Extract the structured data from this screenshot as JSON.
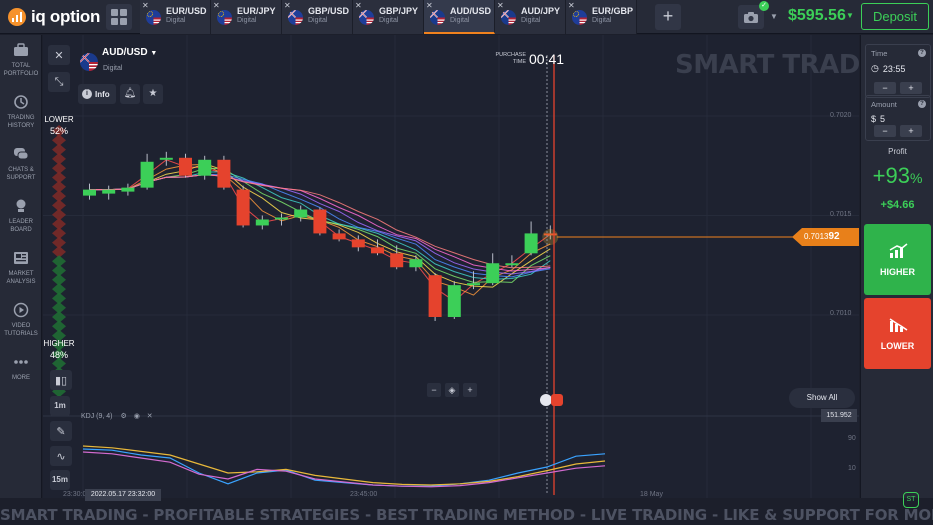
{
  "app": {
    "logo_text": "iq option",
    "balance": "$595.56",
    "deposit_label": "Deposit"
  },
  "tabs": [
    {
      "pair": "EUR/USD",
      "kind": "Digital",
      "active": false
    },
    {
      "pair": "EUR/JPY",
      "kind": "Digital",
      "active": false
    },
    {
      "pair": "GBP/USD",
      "kind": "Digital",
      "active": false
    },
    {
      "pair": "GBP/JPY",
      "kind": "Digital",
      "active": false
    },
    {
      "pair": "AUD/USD",
      "kind": "Digital",
      "active": true
    },
    {
      "pair": "AUD/JPY",
      "kind": "Digital",
      "active": false
    },
    {
      "pair": "EUR/GBP",
      "kind": "Digital",
      "active": false
    }
  ],
  "sidebar": {
    "items": [
      {
        "icon": "briefcase-icon",
        "label": "Total Portfolio"
      },
      {
        "icon": "history-icon",
        "label": "Trading History"
      },
      {
        "icon": "chat-icon",
        "label": "Chats & Support"
      },
      {
        "icon": "trophy-icon",
        "label": "Leader Board"
      },
      {
        "icon": "newspaper-icon",
        "label": "Market Analysis"
      },
      {
        "icon": "play-icon",
        "label": "Video Tutorials"
      },
      {
        "icon": "more-dots-icon",
        "label": "More"
      }
    ]
  },
  "chart": {
    "asset": "AUD/USD",
    "asset_kind": "Digital",
    "info_label": "Info",
    "purchase_label": "PURCHASE TIME",
    "timer": "00:41",
    "watermark": "SMART TRADING",
    "lower_label": "LOWER",
    "lower_pct": "52%",
    "higher_label": "HIGHER",
    "higher_pct": "48%",
    "current_price_prefix": "0.7013",
    "current_price_suffix": "92",
    "y_ticks": [
      "0.7020",
      "0.7015",
      "0.7010"
    ],
    "show_all": "Show All",
    "indicator_label": "KDJ (9, 4)",
    "indicator_value": "151.952",
    "osc_ticks": [
      "90",
      "10"
    ],
    "x_ticks": [
      "23:30:00",
      "23:45:00",
      "18 May"
    ],
    "date_stamp": "2022.05.17 23:32:00",
    "time_buttons": [
      "1m",
      "5m",
      "15m"
    ],
    "candles": [
      {
        "o": 0.7016,
        "c": 0.70163,
        "h": 0.70166,
        "l": 0.70158
      },
      {
        "o": 0.70161,
        "c": 0.70163,
        "h": 0.70165,
        "l": 0.70158
      },
      {
        "o": 0.70162,
        "c": 0.70164,
        "h": 0.70166,
        "l": 0.7016
      },
      {
        "o": 0.70164,
        "c": 0.70177,
        "h": 0.70181,
        "l": 0.70163
      },
      {
        "o": 0.70178,
        "c": 0.70179,
        "h": 0.70182,
        "l": 0.70175
      },
      {
        "o": 0.70179,
        "c": 0.7017,
        "h": 0.70181,
        "l": 0.70169
      },
      {
        "o": 0.7017,
        "c": 0.70178,
        "h": 0.7018,
        "l": 0.70168
      },
      {
        "o": 0.70178,
        "c": 0.70164,
        "h": 0.7018,
        "l": 0.70163
      },
      {
        "o": 0.70163,
        "c": 0.70145,
        "h": 0.70165,
        "l": 0.70144
      },
      {
        "o": 0.70145,
        "c": 0.70148,
        "h": 0.7015,
        "l": 0.70143
      },
      {
        "o": 0.70148,
        "c": 0.70149,
        "h": 0.70151,
        "l": 0.70145
      },
      {
        "o": 0.70149,
        "c": 0.70153,
        "h": 0.70155,
        "l": 0.70147
      },
      {
        "o": 0.70153,
        "c": 0.70141,
        "h": 0.70154,
        "l": 0.7014
      },
      {
        "o": 0.70141,
        "c": 0.70138,
        "h": 0.70143,
        "l": 0.70137
      },
      {
        "o": 0.70138,
        "c": 0.70134,
        "h": 0.7014,
        "l": 0.70132
      },
      {
        "o": 0.70134,
        "c": 0.70131,
        "h": 0.70138,
        "l": 0.7013
      },
      {
        "o": 0.70131,
        "c": 0.70124,
        "h": 0.70135,
        "l": 0.70123
      },
      {
        "o": 0.70124,
        "c": 0.70128,
        "h": 0.7013,
        "l": 0.70122
      },
      {
        "o": 0.7012,
        "c": 0.70099,
        "h": 0.70121,
        "l": 0.70097
      },
      {
        "o": 0.70099,
        "c": 0.70115,
        "h": 0.70117,
        "l": 0.70098
      },
      {
        "o": 0.70115,
        "c": 0.70116,
        "h": 0.70122,
        "l": 0.70113
      },
      {
        "o": 0.70116,
        "c": 0.70126,
        "h": 0.70131,
        "l": 0.70115
      },
      {
        "o": 0.70126,
        "c": 0.70126,
        "h": 0.7013,
        "l": 0.70124
      },
      {
        "o": 0.70131,
        "c": 0.70141,
        "h": 0.70147,
        "l": 0.7013
      },
      {
        "o": 0.70141,
        "c": 0.7014,
        "h": 0.70145,
        "l": 0.70138
      }
    ]
  },
  "trade": {
    "time_label": "Time",
    "time_value": "23:55",
    "amount_label": "Amount",
    "amount_currency": "$",
    "amount_value": "5",
    "profit_label": "Profit",
    "profit_pct": "+93",
    "profit_pct_sign": "%",
    "profit_amount": "+$4.66",
    "higher_label": "HIGHER",
    "lower_label": "LOWER"
  },
  "banner": "SMART TRADING - PROFITABLE STRATEGIES - BEST TRADING METHOD - LIVE TRADING - LIKE & SUPPORT FOR MORE FREE STRATEGIES",
  "colors": {
    "up": "#3ccf58",
    "down": "#e5432d",
    "accent": "#f0821e",
    "background": "#1c1f2b"
  }
}
